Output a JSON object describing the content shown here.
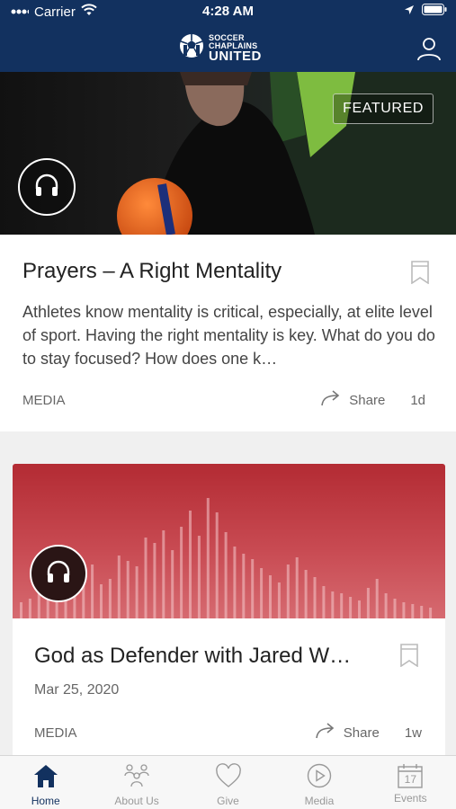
{
  "status_bar": {
    "carrier": "Carrier",
    "time": "4:28 AM"
  },
  "header": {
    "logo_line1": "SOCCER",
    "logo_line2": "CHAPLAINS",
    "logo_line3": "UNITED"
  },
  "featured_post": {
    "badge": "FEATURED",
    "title": "Prayers – A Right Mentality",
    "description": "Athletes know mentality is critical, especially, at elite level of sport. Having the right mentality is key. What do you do to stay focused? How does one k…",
    "category": "MEDIA",
    "share_label": "Share",
    "age": "1d"
  },
  "second_post": {
    "title": "God as Defender with Jared W…",
    "date": "Mar 25, 2020",
    "category": "MEDIA",
    "share_label": "Share",
    "age": "1w"
  },
  "tabs": [
    {
      "label": "Home",
      "icon": "home-icon"
    },
    {
      "label": "About Us",
      "icon": "people-icon"
    },
    {
      "label": "Give",
      "icon": "heart-icon"
    },
    {
      "label": "Media",
      "icon": "play-icon"
    },
    {
      "label": "Events",
      "icon": "calendar-icon",
      "calendar_day": "17"
    }
  ],
  "colors": {
    "brand": "#12315f",
    "hero_red": "#b32b33"
  }
}
